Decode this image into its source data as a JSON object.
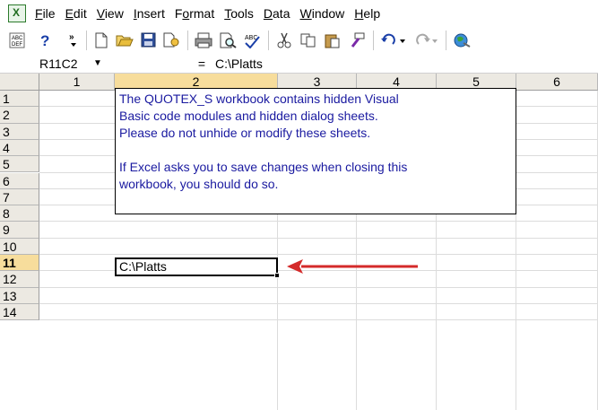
{
  "menu": {
    "items": [
      {
        "label": "File",
        "u": "F",
        "rest": "ile"
      },
      {
        "label": "Edit",
        "u": "E",
        "rest": "dit"
      },
      {
        "label": "View",
        "u": "V",
        "rest": "iew"
      },
      {
        "label": "Insert",
        "u": "I",
        "rest": "nsert"
      },
      {
        "label": "Format",
        "u": "o",
        "pre": "F",
        "rest": "rmat"
      },
      {
        "label": "Tools",
        "u": "T",
        "rest": "ools"
      },
      {
        "label": "Data",
        "u": "D",
        "rest": "ata"
      },
      {
        "label": "Window",
        "u": "W",
        "rest": "indow"
      },
      {
        "label": "Help",
        "u": "H",
        "rest": "elp"
      }
    ]
  },
  "toolbar": {
    "icons": [
      "spelling-abc-icon",
      "help-question-icon",
      "toolbar-overflow-icon",
      "new-icon",
      "open-icon",
      "save-icon",
      "permission-icon",
      "print-icon",
      "print-preview-icon",
      "spelling-icon",
      "cut-icon",
      "copy-icon",
      "paste-icon",
      "format-painter-icon",
      "undo-icon",
      "redo-icon",
      "hyperlink-icon"
    ]
  },
  "formula_bar": {
    "name_box": "R11C2",
    "equals": "=",
    "value": "C:\\Platts"
  },
  "grid": {
    "columns": [
      "1",
      "2",
      "3",
      "4",
      "5",
      "6"
    ],
    "rows": [
      "1",
      "2",
      "3",
      "4",
      "5",
      "6",
      "7",
      "8",
      "9",
      "10",
      "11",
      "12",
      "13",
      "14"
    ],
    "active_row": "11",
    "active_column": "2"
  },
  "note": {
    "line1": "The QUOTEX_S workbook contains hidden Visual",
    "line2": "Basic code modules and hidden dialog sheets.",
    "line3": "Please do not unhide or modify these sheets.",
    "line4": "If Excel asks you to save changes when closing this",
    "line5": "workbook, you should do so."
  },
  "active_cell": {
    "value": "C:\\Platts"
  },
  "colors": {
    "note_text": "#1a1aa0",
    "arrow": "#d42a2a",
    "header_active": "#f7dd9c"
  }
}
